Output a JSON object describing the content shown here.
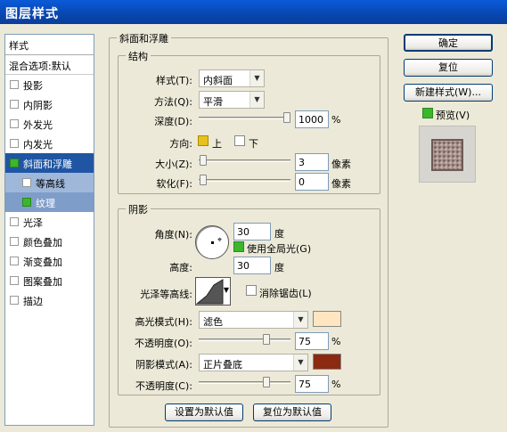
{
  "window": {
    "title": "图层样式"
  },
  "sidebar": {
    "header": "样式",
    "blending": "混合选项:默认",
    "items": [
      {
        "label": "投影",
        "checked": false
      },
      {
        "label": "内阴影",
        "checked": false
      },
      {
        "label": "外发光",
        "checked": false
      },
      {
        "label": "内发光",
        "checked": false
      },
      {
        "label": "斜面和浮雕",
        "checked": true
      },
      {
        "label": "等高线",
        "checked": false
      },
      {
        "label": "纹理",
        "checked": true
      },
      {
        "label": "光泽",
        "checked": false
      },
      {
        "label": "颜色叠加",
        "checked": false
      },
      {
        "label": "渐变叠加",
        "checked": false
      },
      {
        "label": "图案叠加",
        "checked": false
      },
      {
        "label": "描边",
        "checked": false
      }
    ]
  },
  "bevel": {
    "section_title": "斜面和浮雕",
    "structure": {
      "title": "结构",
      "style_label": "样式(T):",
      "style_value": "内斜面",
      "technique_label": "方法(Q):",
      "technique_value": "平滑",
      "depth_label": "深度(D):",
      "depth_value": "1000",
      "depth_unit": "%",
      "depth_level": 1.0,
      "direction_label": "方向:",
      "direction_up": "上",
      "direction_down": "下",
      "direction_selected": "上",
      "size_label": "大小(Z):",
      "size_value": "3",
      "size_unit": "像素",
      "soften_label": "软化(F):",
      "soften_value": "0",
      "soften_unit": "像素"
    },
    "shading": {
      "title": "阴影",
      "angle_label": "角度(N):",
      "angle_value": "30",
      "angle_unit": "度",
      "global_light_label": "使用全局光(G)",
      "global_light_checked": true,
      "altitude_label": "高度:",
      "altitude_value": "30",
      "altitude_unit": "度",
      "gloss_contour_label": "光泽等高线:",
      "antialias_label": "消除锯齿(L)",
      "antialias_checked": false,
      "highlight_mode_label": "高光模式(H):",
      "highlight_mode_value": "滤色",
      "highlight_color": "#ffe5c0",
      "highlight_opacity_label": "不透明度(O):",
      "highlight_opacity_value": "75",
      "highlight_opacity_unit": "%",
      "shadow_mode_label": "阴影模式(A):",
      "shadow_mode_value": "正片叠底",
      "shadow_color": "#8b2a10",
      "shadow_opacity_label": "不透明度(C):",
      "shadow_opacity_value": "75",
      "shadow_opacity_unit": "%"
    },
    "make_default": "设置为默认值",
    "reset_default": "复位为默认值"
  },
  "buttons": {
    "ok": "确定",
    "reset": "复位",
    "new_style": "新建样式(W)...",
    "preview": "预览(V)",
    "preview_checked": true
  },
  "colors": {
    "selected": "#1f55a3",
    "check": "#3cb62a"
  }
}
